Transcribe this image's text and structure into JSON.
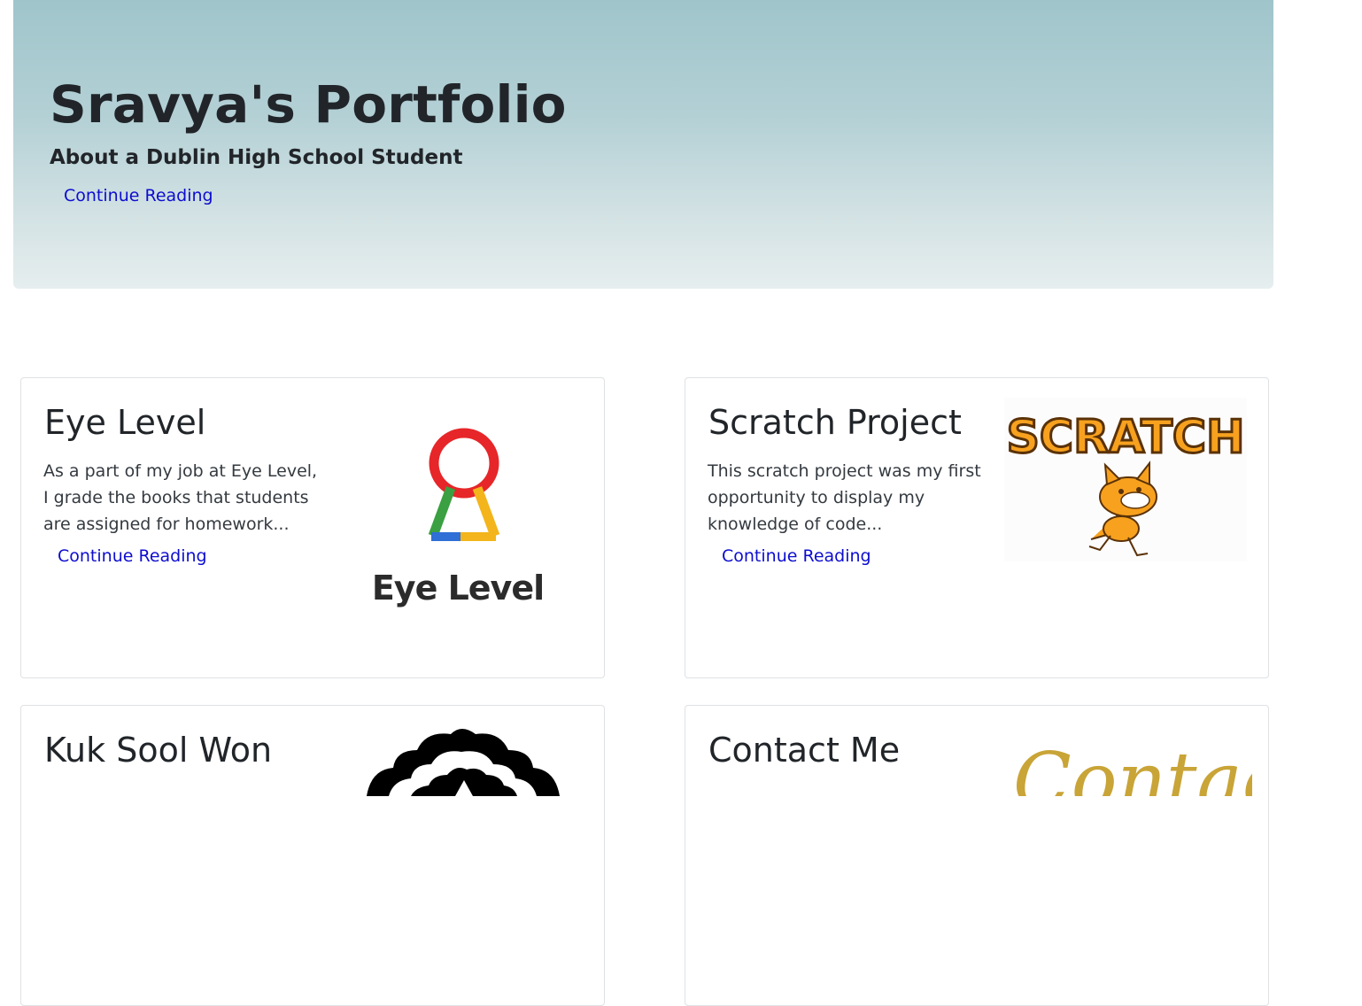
{
  "hero": {
    "title": "Sravya's Portfolio",
    "subtitle": "About a Dublin High School Student",
    "link": "Continue Reading"
  },
  "cards": [
    {
      "title": "Eye Level",
      "text": "As a part of my job at Eye Level, I grade the books that students are assigned for homework...",
      "link": "Continue Reading",
      "image_text": "Eye Level"
    },
    {
      "title": "Scratch Project",
      "text": "This scratch project was my first opportunity to display my knowledge of code...",
      "link": "Continue Reading",
      "image_text": "SCRATCH"
    },
    {
      "title": "Kuk Sool Won",
      "text": "",
      "link": ""
    },
    {
      "title": "Contact Me",
      "text": "",
      "link": "",
      "image_text": "Contact"
    }
  ],
  "colors": {
    "link": "#0d0dcf",
    "text": "#212529",
    "hero_gradient_top": "#9fc5cb",
    "hero_gradient_bottom": "#e6eeef",
    "card_border": "#dfe1e4"
  }
}
